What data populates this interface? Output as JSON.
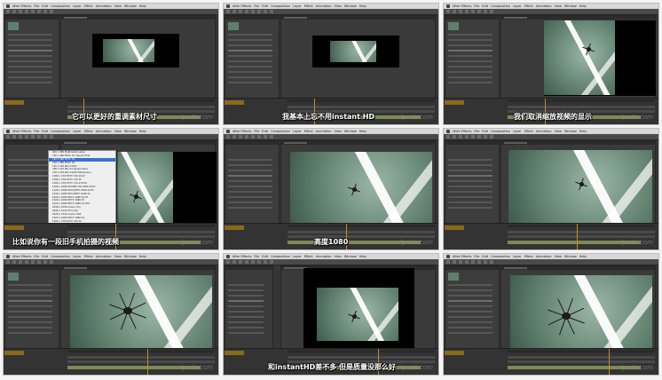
{
  "app": {
    "menus": [
      "After Effects",
      "File",
      "Edit",
      "Composition",
      "Layer",
      "Effect",
      "Animation",
      "View",
      "Window",
      "Help"
    ]
  },
  "watermark": "lynda.com",
  "panels": [
    {
      "subtitle": "它可以更好的重调素材尺寸",
      "layout": "letterbox-small"
    },
    {
      "subtitle": "我基本上忘不用instant HD",
      "layout": "letterbox-small-b"
    },
    {
      "subtitle": "我们取消缩放视频的显示",
      "layout": "zoom-frame"
    },
    {
      "subtitle": "比如说你有一段旧手机拍摄的视频",
      "layout": "dropdown"
    },
    {
      "subtitle": "高度1080",
      "layout": "frame-large"
    },
    {
      "subtitle": "",
      "layout": "frame-wide"
    },
    {
      "subtitle": "",
      "layout": "closeup"
    },
    {
      "subtitle": "和instantHD差不多 但是质量没那么好",
      "layout": "frame-center"
    },
    {
      "subtitle": "",
      "layout": "closeup-b"
    }
  ],
  "dropdown_options": [
    "640 x 480 Multimedia Large",
    "720 x 480 NTSC D1 Square Pixel",
    "720 x 480 NTSC D1",
    "720 x 486 NTSC D1",
    "720 x 576 PAL D1/DV",
    "768 x 576 PAL D1 Square Pixel",
    "720 x 576 PAL D1/DV Widescreen",
    "1280 x 720 HDTV 720 29.97",
    "1280 x 720 HDTV 720 25",
    "1280 x 720 HDTV 720 23.976",
    "1280 x 1080 DVCPRO HD 1080 29.97",
    "1440 x 1080 HDV/HDTV 1080 29.97",
    "1440 x 1080 HDV/HDTV 1080 25",
    "1920 x 1080 HDTV 1080 29.97",
    "1920 x 1080 HDTV 1080 25",
    "1920 x 1080 HDTV 1080 23.976",
    "2048 x 1556 Cineon Full",
    "4096 x 3112 Film (4K)",
    "1828 x 1332 Cineon Half",
    "1920 x 1080 HDTV 1080 24",
    "1280 x 720 HDTV 720 24",
    "960 x 720 DVCPRO HD 720 23.976",
    "1440 x 1080 HDV 1080 24",
    "720 x 480 NTSC DV Widescreen",
    "720 x 576 PAL DV Widescreen"
  ],
  "dropdown_selected_index": 2
}
